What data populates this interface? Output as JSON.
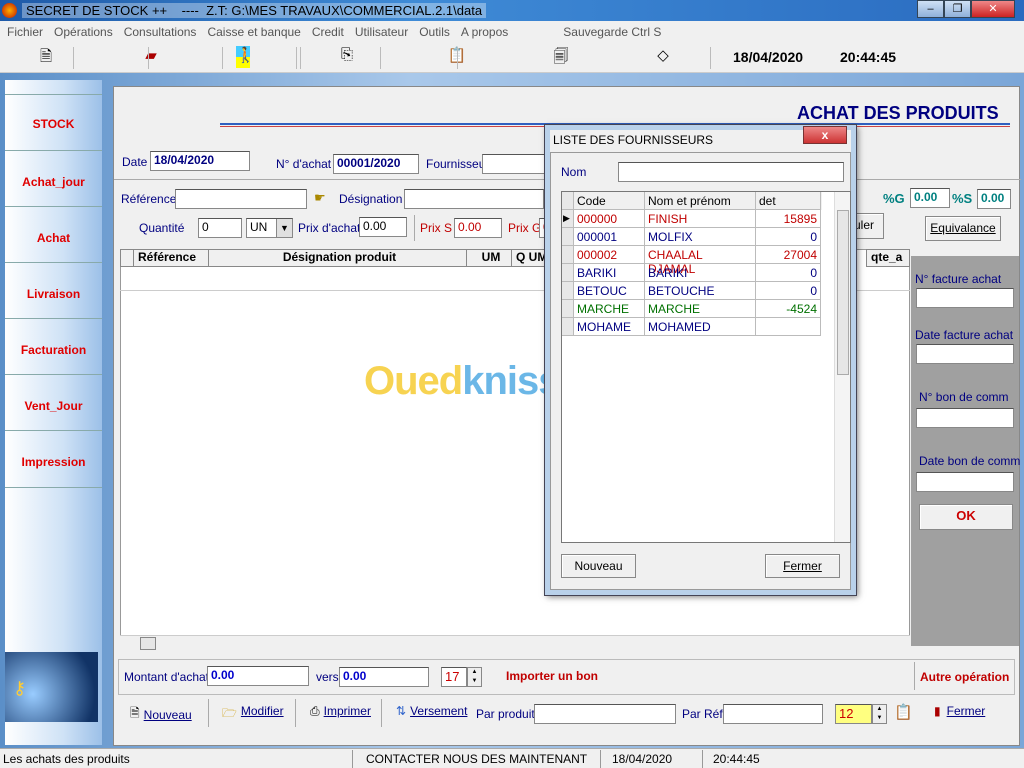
{
  "window": {
    "title": "SECRET DE STOCK ++    ----  Z.T: G:\\MES TRAVAUX\\COMMERCIAL.2.1\\data",
    "minimize": "–",
    "maximize": "❐",
    "close": "✕"
  },
  "menu": [
    "Fichier",
    "Opérations",
    "Consultations",
    "Caisse et banque",
    "Credit",
    "Utilisateur",
    "Outils",
    "A propos",
    "Sauvegarde Ctrl S"
  ],
  "toolbar": {
    "date": "18/04/2020",
    "time": "20:44:45"
  },
  "sidebar": [
    "STOCK",
    "Achat_jour",
    "Achat",
    "Livraison",
    "Facturation",
    "Vent_Jour",
    "Impression"
  ],
  "main": {
    "title": "ACHAT DES PRODUITS",
    "date_label": "Date",
    "date_value": "18/04/2020",
    "num_label": "N° d'achat",
    "num_value": "00001/2020",
    "fournisseur_label": "Fournisseur",
    "fournisseur_value": "",
    "reference_label": "Référence",
    "reference_value": "",
    "designation_label": "Désignation",
    "designation_value": "",
    "quantite_label": "Quantité",
    "quantite_value": "0",
    "unit_value": "UN",
    "prix_achat_label": "Prix d'achat",
    "prix_achat_value": "0.00",
    "prix_s_label": "Prix S",
    "prix_s_value": "0.00",
    "prix_g_label": "Prix G",
    "prix_g_value": "0",
    "pct_g_label": "%G",
    "pct_g_value": "0.00",
    "pct_s_label": "%S",
    "pct_s_value": "0.00",
    "calculer_label": "uler",
    "equivalance_label": "Equivalance",
    "columns": [
      "Référence",
      "Désignation produit",
      "UM",
      "Q UM",
      "qte_a"
    ],
    "right": {
      "facture_label": "N° facture achat",
      "date_facture_label": "Date facture achat",
      "bon_label": "N° bon de comm",
      "date_bon_label": "Date bon de comm",
      "ok": "OK"
    },
    "montant_label": "Montant d'achat",
    "montant_value": "0.00",
    "vers_label": "vers",
    "vers_value": "0.00",
    "spin1": "17",
    "importer": "Importer un bon",
    "autre": "Autre opération",
    "nouveau": "Nouveau",
    "modifier": "Modifier",
    "imprimer": "Imprimer",
    "versement": "Versement",
    "par_produit": "Par produit",
    "par_ref": "Par Réf",
    "spin2": "12",
    "fermer": "Fermer"
  },
  "watermark": "Ouedkniss.com",
  "dialog": {
    "title": "LISTE DES FOURNISSEURS",
    "close": "x",
    "nom_label": "Nom",
    "nom_value": "",
    "columns": [
      "Code",
      "Nom et prénom",
      "det"
    ],
    "rows": [
      {
        "code": "000000",
        "nom": "FINISH",
        "det": "15895",
        "color": "#c00000"
      },
      {
        "code": "000001",
        "nom": "MOLFIX",
        "det": "0",
        "color": "#000080"
      },
      {
        "code": "000002",
        "nom": "CHAALAL DJAMAL",
        "det": "27004",
        "color": "#c00000"
      },
      {
        "code": "BARIKI",
        "nom": "BARIKI",
        "det": "0",
        "color": "#000080"
      },
      {
        "code": "BETOUC",
        "nom": "BETOUCHE",
        "det": "0",
        "color": "#000080"
      },
      {
        "code": "MARCHE",
        "nom": "MARCHE",
        "det": "-4524",
        "color": "#007000"
      },
      {
        "code": "MOHAME",
        "nom": "MOHAMED",
        "det": "",
        "color": "#000080"
      }
    ],
    "nouveau": "Nouveau",
    "fermer": "Fermer"
  },
  "status": {
    "left": "Les achats des produits",
    "contact": "CONTACTER NOUS DES MAINTENANT",
    "date": "18/04/2020",
    "time": "20:44:45"
  }
}
